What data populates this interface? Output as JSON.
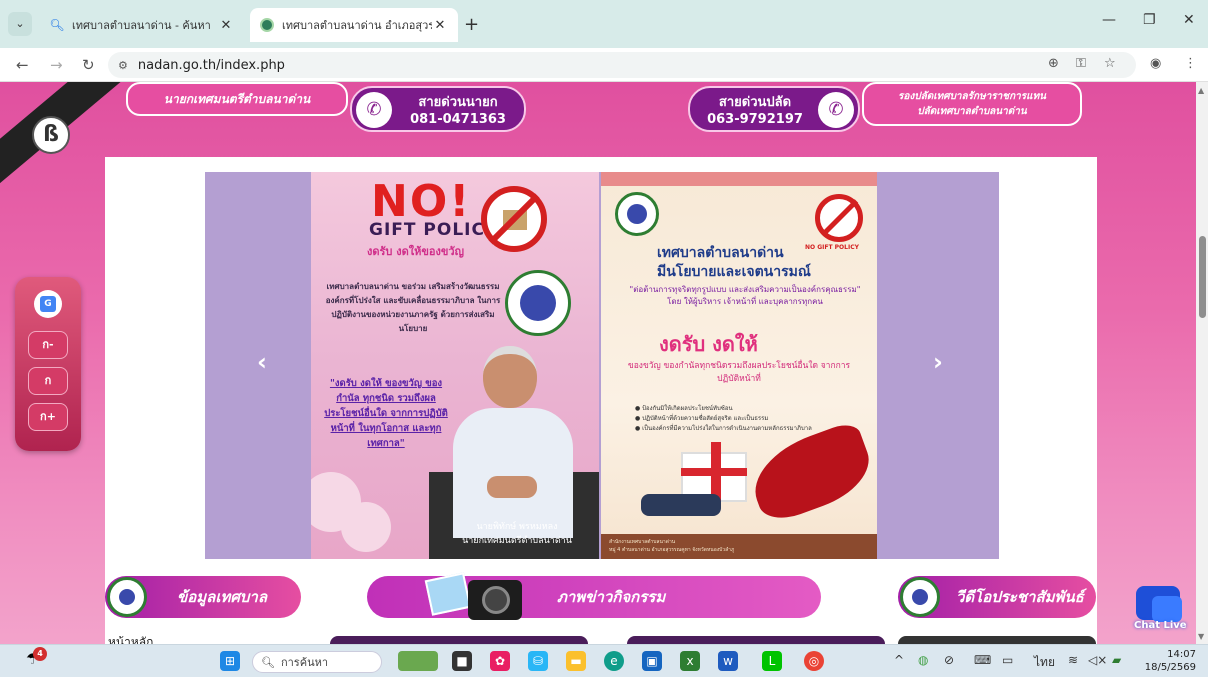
{
  "browser": {
    "tabs": [
      {
        "title": "เทศบาลตำบลนาด่าน - ค้นหา",
        "active": false
      },
      {
        "title": "เทศบาลตำบลนาด่าน อำเภอสุวรรณคูหา",
        "active": true
      }
    ],
    "new_tab": "+",
    "url": "nadan.go.th/index.php",
    "controls": {
      "minimize": "—",
      "restore": "❐",
      "close": "✕"
    }
  },
  "header": {
    "mayor_title": "นายกเทศมนตรีตำบลนาด่าน",
    "hotline_mayor": {
      "label": "สายด่วนนายก",
      "number": "081-0471363"
    },
    "hotline_deputy": {
      "label": "สายด่วนปลัด",
      "number": "063-9792197"
    },
    "deputy_line1": "รองปลัดเทศบาลรักษาราชการแทน",
    "deputy_line2": "ปลัดเทศบาลตำบลนาด่าน"
  },
  "carousel": {
    "prev": "‹",
    "next": "›",
    "slide1": {
      "headline_no": "NO!",
      "headline_policy": "GIFT POLICY",
      "slogan": "งดรับ งดให้ของขวัญ",
      "body": "เทศบาลตำบลนาด่าน ขอร่วม เสริมสร้างวัฒนธรรมองค์กรที่โปร่งใส และขับเคลื่อนธรรมาภิบาล ในการปฏิบัติงานของหน่วยงานภาครัฐ ด้วยการส่งเสริมนโยบาย",
      "quote": "\"งดรับ งดให้ ของขวัญ ของกำนัล ทุกชนิด รวมถึงผลประโยชน์อื่นใด จากการปฏิบัติหน้าที่ ในทุกโอกาส และทุกเทศกาล\"",
      "name": "นายพิทักษ์ พรหมหลง",
      "position": "นายกเทศมนตรีตำบลนาด่าน"
    },
    "slide2": {
      "no_gift_label": "NO GIFT POLICY",
      "title_line1": "เทศบาลตำบลนาด่าน",
      "title_line2": "มีนโยบายและเจตนารมณ์",
      "subtitle": "\"ต่อต้านการทุจริตทุกรูปแบบ และส่งเสริมความเป็นองค์กรคุณธรรม\" โดย ให้ผู้บริหาร เจ้าหน้าที่ และบุคลากรทุกคน",
      "big": "งดรับ งดให้",
      "line": "ของขวัญ ของกำนัลทุกชนิดรวมถึงผลประโยชน์อื่นใด จากการปฏิบัติหน้าที่",
      "bullets": [
        "ป้องกันมิให้เกิดผลประโยชน์ทับซ้อน",
        "ปฏิบัติหน้าที่ด้วยความซื่อสัตย์สุจริต และเป็นธรรม",
        "เป็นองค์กรที่มีความโปร่งใสในการดำเนินงานตามหลักธรรมาภิบาล"
      ],
      "footer_line1": "สำนักงานเทศบาลตำบลนาด่าน",
      "footer_line2": "หมู่ 4 ตำบลนาด่าน อำเภอสุวรรณคูหา จังหวัดหนองบัวลำภู"
    }
  },
  "a11y": {
    "decrease": "ก-",
    "normal": "ก",
    "increase": "ก+"
  },
  "sections": {
    "info": "ข้อมูลเทศบาล",
    "news": "ภาพข่าวกิจกรรม",
    "video": "วีดีโอประชาสัมพันธ์"
  },
  "home_link": "หน้าหลัก",
  "chat": {
    "label": "Chat Live"
  },
  "taskbar": {
    "weather_badge": "4",
    "search_placeholder": "การค้นหา",
    "language": "ไทย",
    "time": "14:07",
    "date": "18/5/2569"
  }
}
